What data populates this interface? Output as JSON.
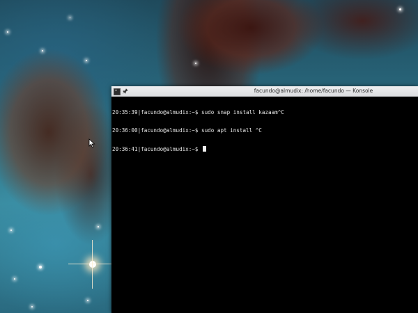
{
  "desktop": {
    "wallpaper": "nebula-space-image"
  },
  "terminal": {
    "title": "facundo@almudix: /home/facundo — Konsole",
    "icons": {
      "app": "konsole-icon",
      "pin": "pin-icon"
    },
    "lines": [
      "20:35:39|facundo@almudix:~$ sudo snap install kazaam^C",
      "20:36:00|facundo@almudix:~$ sudo apt install ^C",
      "20:36:41|facundo@almudix:~$ "
    ],
    "colors": {
      "background": "#000000",
      "foreground": "#e8e8e8",
      "titlebar": "#eff0f1"
    }
  }
}
